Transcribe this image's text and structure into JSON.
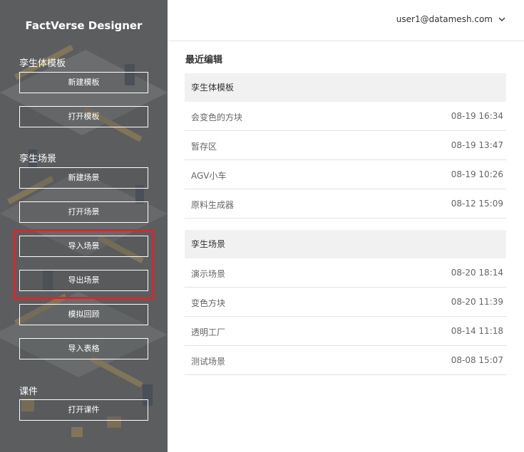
{
  "app": {
    "title": "FactVerse Designer"
  },
  "sidebar": {
    "sections": [
      {
        "label": "孪生体模板",
        "buttons": [
          "新建模板",
          "打开模板"
        ]
      },
      {
        "label": "孪生场景",
        "buttons": [
          "新建场景",
          "打开场景",
          "导入场景",
          "导出场景",
          "模拟回顾",
          "导入表格"
        ]
      },
      {
        "label": "课件",
        "buttons": [
          "打开课件"
        ]
      }
    ]
  },
  "header": {
    "user_email": "user1@datamesh.com"
  },
  "main": {
    "recent_title": "最近编辑",
    "groups": [
      {
        "label": "孪生体模板",
        "items": [
          {
            "name": "会变色的方块",
            "time": "08-19 16:34"
          },
          {
            "name": "暂存区",
            "time": "08-19 13:47"
          },
          {
            "name": "AGV小车",
            "time": "08-19 10:26"
          },
          {
            "name": "原料生成器",
            "time": "08-12 15:09"
          }
        ]
      },
      {
        "label": "孪生场景",
        "items": [
          {
            "name": "演示场景",
            "time": "08-20 18:14"
          },
          {
            "name": "变色方块",
            "time": "08-20 11:39"
          },
          {
            "name": "透明工厂",
            "time": "08-14 11:18"
          },
          {
            "name": "测试场景",
            "time": "08-08 15:07"
          }
        ]
      }
    ]
  },
  "colors": {
    "sidebar_bg": "#5b5d5f",
    "highlight": "#d9262b",
    "group_header_bg": "#f1f1f1"
  }
}
